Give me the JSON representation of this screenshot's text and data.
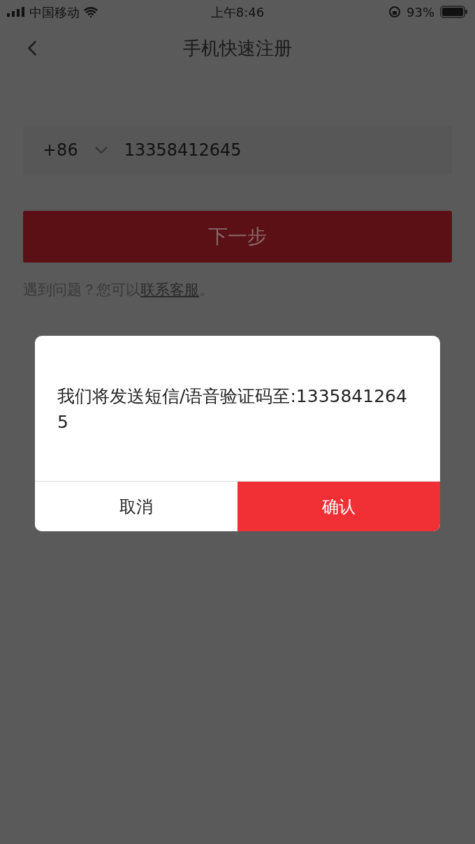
{
  "status_bar": {
    "carrier": "中国移动",
    "time": "上午8:46",
    "battery": "93%"
  },
  "nav": {
    "title": "手机快速注册"
  },
  "phone_field": {
    "country_code": "+86",
    "value": "13358412645"
  },
  "next_button": {
    "label": "下一步",
    "disabled": true
  },
  "help": {
    "text_before": "遇到问题？您可以",
    "link": "联系客服",
    "text_after": "。"
  },
  "dialog": {
    "message": "我们将发送短信/语音验证码至:13358412645",
    "buttons": [
      {
        "label": "取消",
        "kind": "cancel"
      },
      {
        "label": "确认",
        "kind": "confirm"
      }
    ]
  }
}
